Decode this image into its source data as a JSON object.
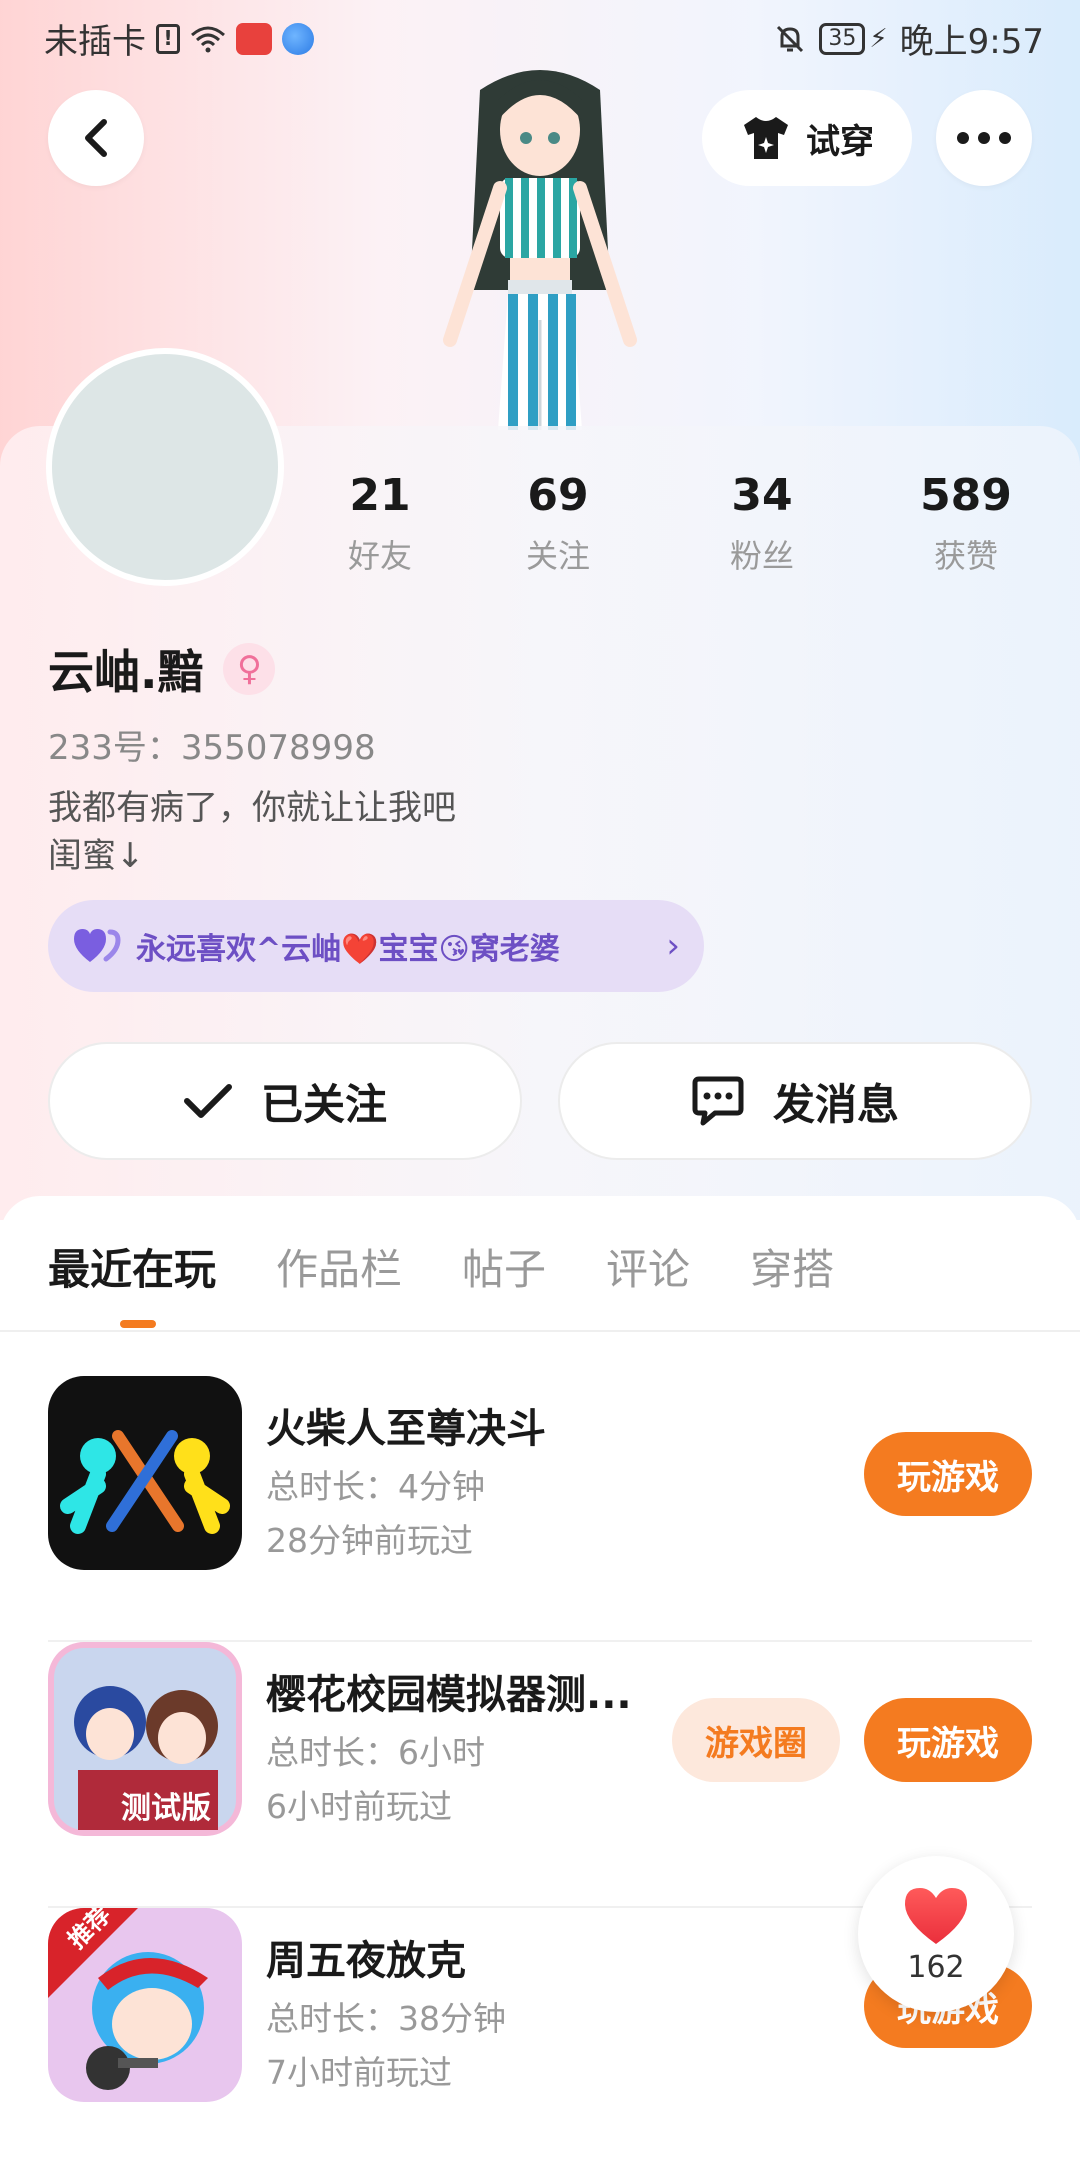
{
  "status_bar": {
    "carrier": "未插卡",
    "battery": "35",
    "time": "晚上9:57"
  },
  "header": {
    "try_on_label": "试穿"
  },
  "stats": [
    {
      "value": "21",
      "label": "好友"
    },
    {
      "value": "69",
      "label": "关注"
    },
    {
      "value": "34",
      "label": "粉丝"
    },
    {
      "value": "589",
      "label": "获赞"
    }
  ],
  "profile": {
    "username": "云岫.黯",
    "uid": "233号：355078998",
    "bio_line1": "我都有病了，你就让让我吧",
    "bio_line2": "闺蜜↓",
    "relation_text": "永远喜欢^云岫❤️宝宝😘窝老婆"
  },
  "actions": {
    "follow_label": "已关注",
    "message_label": "发消息"
  },
  "tabs": [
    "最近在玩",
    "作品栏",
    "帖子",
    "评论",
    "穿搭"
  ],
  "games": [
    {
      "title": "火柴人至尊决斗",
      "duration": "总时长：4分钟",
      "last_played": "28分钟前玩过",
      "play_label": "玩游戏"
    },
    {
      "title": "樱花校园模拟器测...",
      "duration": "总时长：6小时",
      "last_played": "6小时前玩过",
      "circle_label": "游戏圈",
      "play_label": "玩游戏",
      "badge": "测试版"
    },
    {
      "title": "周五夜放克",
      "duration": "总时长：38分钟",
      "last_played": "7小时前玩过",
      "play_label": "玩游戏",
      "badge": "推荐"
    }
  ],
  "like": {
    "count": "162"
  },
  "colors": {
    "accent": "#f47b20",
    "relation_bg": "#e6ddf6",
    "relation_text": "#6d4fc4"
  }
}
